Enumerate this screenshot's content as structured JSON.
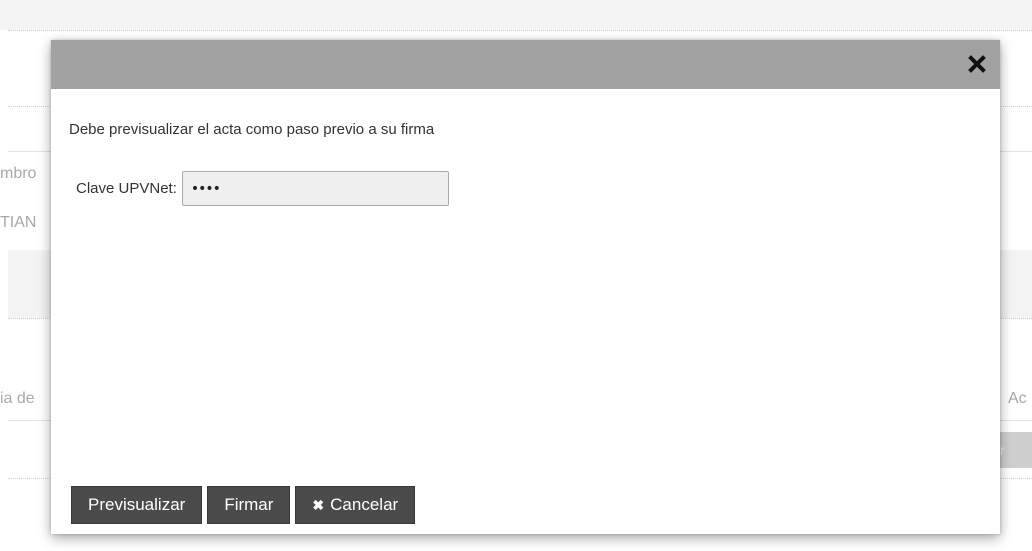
{
  "background": {
    "left_fragments": [
      "mbro",
      "TIAN",
      "ia de"
    ],
    "right_fragment": "Ac",
    "side_button_glyph": "r"
  },
  "modal": {
    "close_icon": "close-icon",
    "message": "Debe previsualizar el acta como paso previo a su firma",
    "password": {
      "label": "Clave UPVNet:",
      "value": "••••"
    },
    "buttons": {
      "preview_label": "Previsualizar",
      "sign_label": "Firmar",
      "cancel_label": "Cancelar",
      "cancel_icon": "close-icon"
    }
  },
  "colors": {
    "titlebar": "#a2a2a2",
    "button_bg": "#4b4b4b",
    "button_text": "#ffffff",
    "input_bg": "#efefef"
  }
}
